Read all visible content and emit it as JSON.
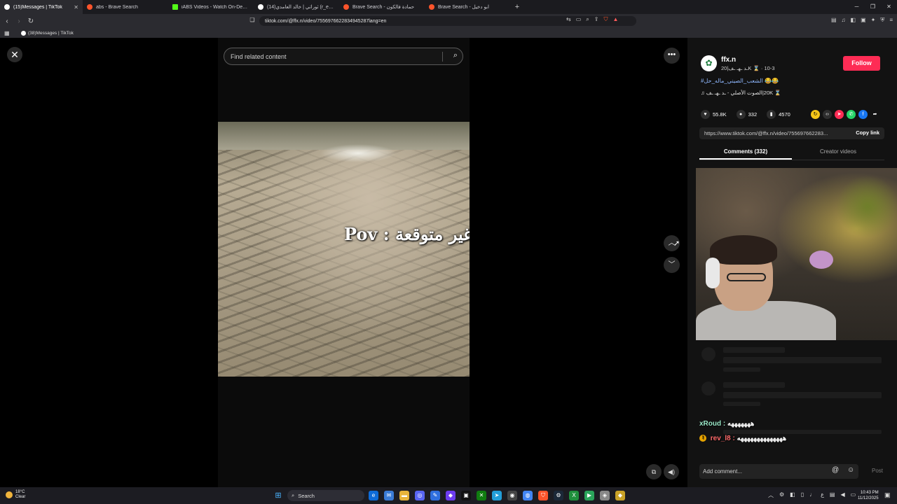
{
  "browser": {
    "tabs": [
      {
        "label": "(15)Messages | TikTok",
        "color": "#ffffff",
        "active": true
      },
      {
        "label": "abs - Brave Search",
        "color": "#fb542b"
      },
      {
        "label": "iABS Videos - Watch On-Demand on...",
        "color": "#53fc18"
      },
      {
        "label": "(14)ثوراتي | خالد العامدي (r_e7xx@)",
        "color": "#ffffff"
      },
      {
        "label": "Brave Search - حمادة فالكون",
        "color": "#fb542b"
      },
      {
        "label": "Brave Search - ابو دخيل",
        "color": "#fb542b"
      }
    ],
    "url": "tiktok.com/@ffx.n/video/7556976622834945287lang=en",
    "bookmark": "(38)Messages | TikTok"
  },
  "viewer": {
    "search_placeholder": "Find related content",
    "video_caption": "Pov : غير متوقعة"
  },
  "panel": {
    "username": "ffx.n",
    "user_sub": "20|ـد ـهـ ـف‎K ⌛ · 10-3",
    "follow_label": "Follow",
    "hashtag": "#الشعب_الصيني_ماله_حل 😂😂",
    "music": "♫ الصوت الأصلي - ـد ـهـ ـف‎|20K ⌛",
    "stats": {
      "likes": "55.8K",
      "comments": "332",
      "saves": "4570"
    },
    "link": "https://www.tiktok.com/@ffx.n/video/755697662283...",
    "copy_label": "Copy link",
    "tab_comments": "Comments (332)",
    "tab_creator": "Creator videos",
    "chat": [
      {
        "name": "xRoud :",
        "msg": "هههههههه"
      },
      {
        "name": "rev_l8 :",
        "msg": "ههههههههههههههه"
      }
    ],
    "comment_placeholder": "Add comment...",
    "post_label": "Post"
  },
  "taskbar": {
    "temp": "18°C",
    "condition": "Clear",
    "search_label": "Search",
    "time": "10:43 PM",
    "date": "11/12/2025",
    "lang": "ع"
  },
  "colors": {
    "accent": "#fe2c55",
    "hashtag": "#8fb8ff"
  }
}
